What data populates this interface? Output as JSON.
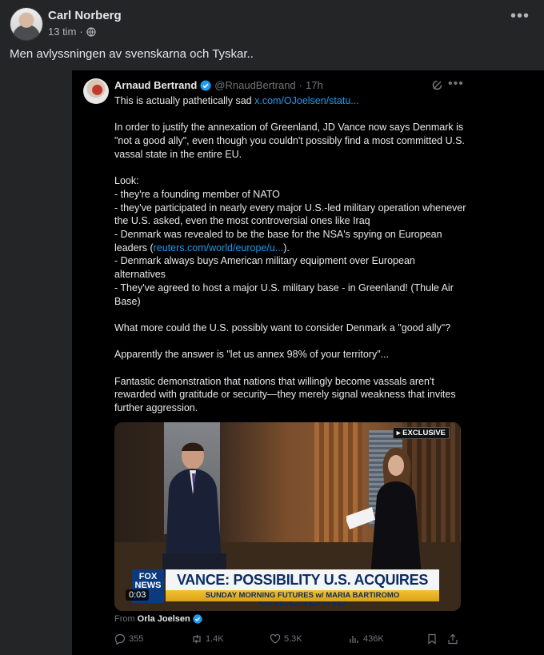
{
  "post": {
    "author": "Carl Norberg",
    "time": "13 tim",
    "separator": "·",
    "caption": "Men avlyssningen av svenskarna och Tyskar.."
  },
  "tweet": {
    "author": "Arnaud Bertrand",
    "handle": "@RnaudBertrand",
    "dot": "·",
    "time": "17h",
    "line1_text": "This is actually pathetically sad ",
    "line1_link": "x.com/OJoelsen/statu...",
    "p1": "In order to justify the annexation of Greenland, JD Vance now says Denmark is \"not a good ally\", even though you couldn't possibly find a most committed U.S. vassal state in the entire EU.",
    "look": "Look:",
    "b1": "- they're a founding member of NATO",
    "b2": "- they've participated in nearly every major U.S.-led military operation whenever the U.S. asked, even the most controversial ones like Iraq",
    "b3_pre": "- Denmark was revealed to be the base for the NSA's spying on European leaders (",
    "b3_link": "reuters.com/world/europe/u...",
    "b3_post": ").",
    "b4": "- Denmark always buys American military equipment over European alternatives",
    "b5": "- They've agreed to host a major U.S. military base - in Greenland! (Thule Air Base)",
    "q": "What more could the U.S. possibly want to consider Denmark a \"good ally\"?",
    "a": "Apparently the answer is \"let us annex 98% of your territory\"...",
    "p_end": "Fantastic demonstration that nations that willingly become vassals aren't rewarded with gratitude or security—they merely signal weakness that invites further aggression.",
    "video": {
      "badge": "▸ EXCLUSIVE",
      "logo": "FOX NEWS",
      "chyron": "VANCE: POSSIBILITY U.S. ACQUIRES GREENLAND",
      "sub": "SUNDAY MORNING FUTURES  w/ MARIA BARTIROMO",
      "timer": "0:03"
    },
    "from_label": "From",
    "from_name": "Orla Joelsen",
    "stats": {
      "replies": "355",
      "reposts": "1.4K",
      "likes": "5.3K",
      "views": "436K"
    }
  },
  "colors": {
    "fb_bg": "#242526",
    "tweet_bg": "#000000",
    "link": "#1d9bf0",
    "verified": "#1d9bf0",
    "muted": "#71767b"
  }
}
